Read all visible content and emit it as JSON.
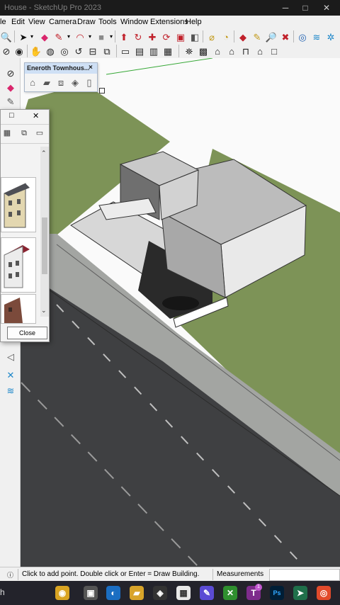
{
  "window": {
    "title": "House - SketchUp Pro 2023"
  },
  "menu": {
    "items": [
      "le",
      "Edit",
      "View",
      "Camera",
      "Draw",
      "Tools",
      "Window",
      "Extensions",
      "Help"
    ]
  },
  "components_toolbar": {
    "title": "Eneroth Townhous...",
    "close": "×"
  },
  "components_panel": {
    "close_button": "Close",
    "restore": "□",
    "close_x": "✕"
  },
  "statusbar": {
    "hint": "Click to add point. Double click or Enter = Draw Building.",
    "measurements_label": "Measurements"
  },
  "taskbar": {
    "search_fragment": "h",
    "badge_count": "1"
  },
  "colors": {
    "grass": "#7d9357",
    "road": "#3f4042",
    "sidewalk": "#9ea09d",
    "taskbar": "#23232b",
    "panel_header": "#cfe0f5"
  }
}
